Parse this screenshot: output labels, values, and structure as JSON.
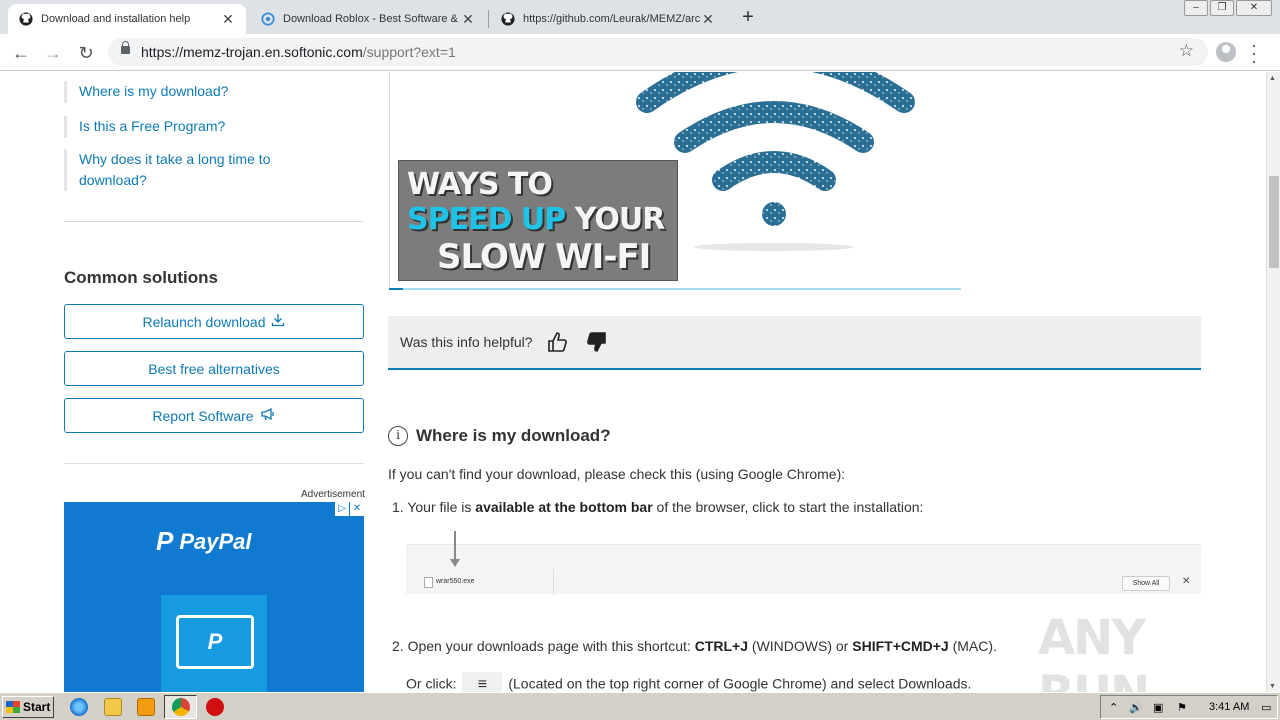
{
  "browser": {
    "tabs": [
      {
        "title": "Download and installation help",
        "active": true,
        "icon": "github-icon"
      },
      {
        "title": "Download Roblox - Best Software & Apps",
        "active": false,
        "icon": "softonic-icon"
      },
      {
        "title": "https://github.com/Leurak/MEMZ/archive",
        "active": false,
        "icon": "github-icon"
      }
    ],
    "url_host": "https://memz-trojan.en.softonic.com",
    "url_path": "/support?ext=1"
  },
  "sidebar": {
    "links": [
      "Where is my download?",
      "Is this a Free Program?",
      "Why does it take a long time to download?"
    ],
    "solutions_title": "Common solutions",
    "solutions": [
      {
        "label": "Relaunch download",
        "icon": "download-icon"
      },
      {
        "label": "Best free alternatives",
        "icon": ""
      },
      {
        "label": "Report Software",
        "icon": "megaphone-icon"
      }
    ],
    "ad_label": "Advertisement",
    "ad_brand": "PayPal"
  },
  "main": {
    "hero_lines": [
      "WAYS TO",
      "SPEED UP",
      "YOUR",
      "SLOW WI-FI"
    ],
    "helpful_question": "Was this info helpful?",
    "section_title": "Where is my download?",
    "intro": "If you can't find your download, please check this (using Google Chrome):",
    "step1_prefix": "1. Your file is ",
    "step1_bold": "available at the bottom bar",
    "step1_suffix": " of the browser, click to start the installation:",
    "bar_file": "wrar550.exe",
    "bar_show_all": "Show All",
    "step2_prefix": "2. Open your downloads page with this shortcut: ",
    "step2_key1": "CTRL+J",
    "step2_mid": " (WINDOWS) or ",
    "step2_key2": "SHIFT+CMD+J",
    "step2_suffix": " (MAC).",
    "step2_or": "Or click:",
    "step2_or_suffix": "(Located on the top right corner of Google Chrome) and select Downloads."
  },
  "watermark": "ANY RUN",
  "taskbar": {
    "start": "Start",
    "time": "3:41 AM"
  },
  "colors": {
    "link": "#0e7ab6",
    "ad_bg": "#0f7ad0",
    "accent_cyan": "#1ec3e8"
  }
}
